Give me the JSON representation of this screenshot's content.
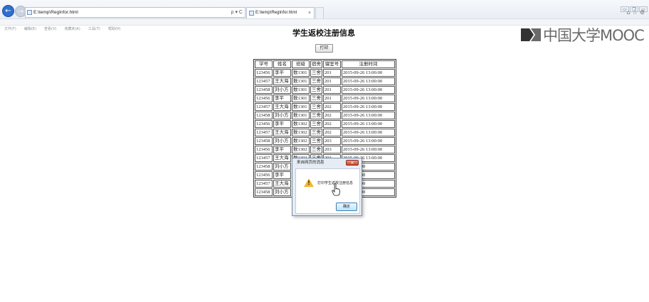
{
  "browser": {
    "address": "E:\\temp\\RegInfor.html",
    "address_tools": "ρ ▾ C",
    "tab_title": "E:\\temp\\RegInfor.html",
    "tab_close": "×",
    "back_glyph": "←",
    "forward_glyph": "→",
    "tool_icons": "⌂☆⚙",
    "window_buttons": [
      "▭",
      "❐",
      "▭"
    ],
    "menu": [
      "文件(F)",
      "编辑(E)",
      "查看(V)",
      "收藏夹(A)",
      "工具(T)",
      "帮助(H)"
    ]
  },
  "page": {
    "title": "学生返校注册信息",
    "print_button": "打印"
  },
  "table": {
    "headers": [
      "学号",
      "姓名",
      "班级",
      "宿舍",
      "寝室号",
      "注册时间"
    ],
    "rows": [
      [
        "123456",
        "李平",
        "数1301",
        "三舍",
        "201",
        "2015-09-26 13:00:00"
      ],
      [
        "123457",
        "王大海",
        "数1301",
        "三舍",
        "201",
        "2015-09-26 13:00:00"
      ],
      [
        "123458",
        "刘小方",
        "数1301",
        "三舍",
        "201",
        "2015-09-26 13:00:00"
      ],
      [
        "123456",
        "李平",
        "数1301",
        "三舍",
        "201",
        "2015-09-26 13:00:00"
      ],
      [
        "123457",
        "王大海",
        "数1301",
        "三舍",
        "202",
        "2015-09-26 13:00:00"
      ],
      [
        "123458",
        "刘小方",
        "数1301",
        "三舍",
        "202",
        "2015-09-26 13:00:00"
      ],
      [
        "123456",
        "李平",
        "数1302",
        "三舍",
        "202",
        "2015-09-26 13:00:00"
      ],
      [
        "123457",
        "王大海",
        "数1302",
        "三舍",
        "202",
        "2015-09-26 13:00:00"
      ],
      [
        "123458",
        "刘小方",
        "数1302",
        "三舍",
        "203",
        "2015-09-26 13:00:00"
      ],
      [
        "123456",
        "李平",
        "数1302",
        "三舍",
        "203",
        "2015-09-26 13:00:00"
      ],
      [
        "123457",
        "王大海",
        "数1303",
        "三舍",
        "203",
        "2015-09-26 13:00:00"
      ],
      [
        "123458",
        "刘小方",
        "",
        "",
        "",
        "26 13:00:00"
      ],
      [
        "123456",
        "李平",
        "",
        "",
        "",
        "26 13:00:00"
      ],
      [
        "123457",
        "王大海",
        "",
        "",
        "",
        "26 13:00:00"
      ],
      [
        "123458",
        "刘小方",
        "",
        "",
        "",
        "26 13:00:00"
      ]
    ]
  },
  "logo": {
    "text": "中国大学MOOC"
  },
  "dialog": {
    "title": "来自网页的消息",
    "message": "打印学生返校注册信息",
    "ok_label": "确定",
    "close_glyph": "✕",
    "icon_glyph": "!"
  },
  "colors": {
    "accent": "#2f6fd0",
    "dialog_close": "#c6432c",
    "warning_icon": "#f2b632",
    "logo_gray": "#6a6a6a"
  },
  "icons": {
    "back": "back-arrow-icon",
    "forward": "forward-arrow-icon",
    "warning": "warning-icon",
    "cursor": "hand-pointer-icon"
  }
}
